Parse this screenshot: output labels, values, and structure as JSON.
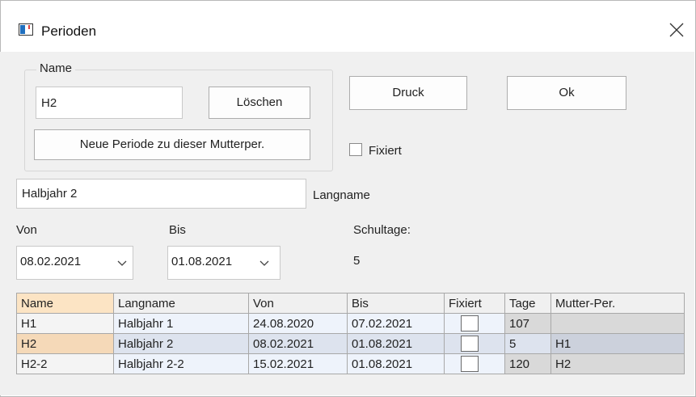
{
  "window": {
    "title": "Perioden",
    "icon": "app-window-icon",
    "close_icon": "close-icon"
  },
  "name_group": {
    "legend": "Name",
    "name_value": "H2",
    "delete_label": "Löschen",
    "new_period_label": "Neue Periode zu dieser Mutterper."
  },
  "print_label": "Druck",
  "ok_label": "Ok",
  "fixed_label": "Fixiert",
  "longname": {
    "value": "Halbjahr 2",
    "label": "Langname"
  },
  "from": {
    "label": "Von",
    "value": "08.02.2021"
  },
  "to": {
    "label": "Bis",
    "value": "01.08.2021"
  },
  "school_days": {
    "label": "Schultage:",
    "value": "5"
  },
  "table": {
    "columns": [
      "Name",
      "Langname",
      "Von",
      "Bis",
      "Fixiert",
      "Tage",
      "Mutter-Per."
    ],
    "rows": [
      {
        "name": "H1",
        "langname": "Halbjahr 1",
        "von": "24.08.2020",
        "bis": "07.02.2021",
        "fixiert": false,
        "tage": "107",
        "mutter": ""
      },
      {
        "name": "H2",
        "langname": "Halbjahr 2",
        "von": "08.02.2021",
        "bis": "01.08.2021",
        "fixiert": false,
        "tage": "5",
        "mutter": "H1"
      },
      {
        "name": "H2-2",
        "langname": "Halbjahr 2-2",
        "von": "15.02.2021",
        "bis": "01.08.2021",
        "fixiert": false,
        "tage": "120",
        "mutter": "H2"
      }
    ]
  }
}
